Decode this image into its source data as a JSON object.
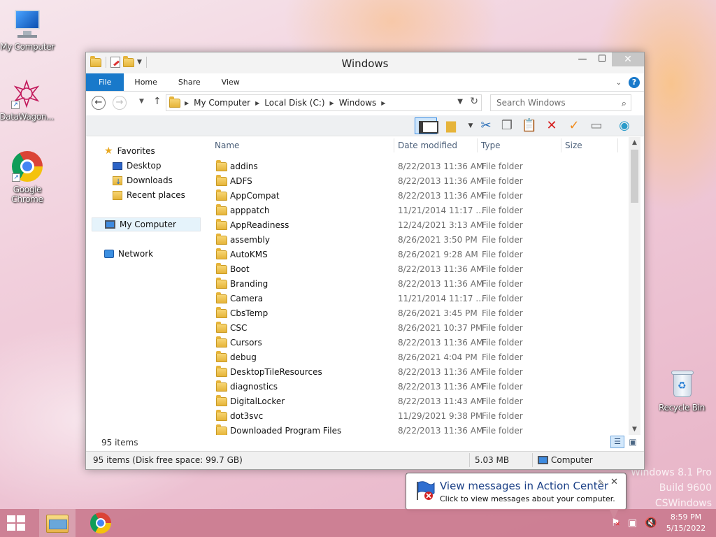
{
  "desktop": {
    "icons": [
      {
        "label": "My Computer",
        "icon": "computer-icon"
      },
      {
        "label": "DataWagon...",
        "icon": "datawagon-icon"
      },
      {
        "label": "Google Chrome",
        "icon": "chrome-icon"
      },
      {
        "label": "Recycle Bin",
        "icon": "recycle-bin-icon"
      }
    ],
    "watermark": {
      "line1": "Windows 8.1 Pro",
      "line2": "Build 9600",
      "line3": "CSWindows"
    }
  },
  "window": {
    "title": "Windows",
    "controls": {
      "minimize": "—",
      "maximize": "☐",
      "close": "✕"
    },
    "ribbon_tabs": [
      "File",
      "Home",
      "Share",
      "View"
    ],
    "address": {
      "crumbs": [
        "My Computer",
        "Local Disk (C:)",
        "Windows"
      ]
    },
    "search_placeholder": "Search Windows",
    "nav": {
      "favorites": "Favorites",
      "desktop": "Desktop",
      "downloads": "Downloads",
      "recent": "Recent places",
      "computer": "My Computer",
      "network": "Network"
    },
    "columns": {
      "name": "Name",
      "date": "Date modified",
      "type": "Type",
      "size": "Size"
    },
    "files": [
      {
        "name": "addins",
        "date": "8/22/2013 11:36 AM",
        "type": "File folder"
      },
      {
        "name": "ADFS",
        "date": "8/22/2013 11:36 AM",
        "type": "File folder"
      },
      {
        "name": "AppCompat",
        "date": "8/22/2013 11:36 AM",
        "type": "File folder"
      },
      {
        "name": "apppatch",
        "date": "11/21/2014 11:17 ...",
        "type": "File folder"
      },
      {
        "name": "AppReadiness",
        "date": "12/24/2021 3:13 AM",
        "type": "File folder"
      },
      {
        "name": "assembly",
        "date": "8/26/2021 3:50 PM",
        "type": "File folder"
      },
      {
        "name": "AutoKMS",
        "date": "8/26/2021 9:28 AM",
        "type": "File folder"
      },
      {
        "name": "Boot",
        "date": "8/22/2013 11:36 AM",
        "type": "File folder"
      },
      {
        "name": "Branding",
        "date": "8/22/2013 11:36 AM",
        "type": "File folder"
      },
      {
        "name": "Camera",
        "date": "11/21/2014 11:17 ...",
        "type": "File folder"
      },
      {
        "name": "CbsTemp",
        "date": "8/26/2021 3:45 PM",
        "type": "File folder"
      },
      {
        "name": "CSC",
        "date": "8/26/2021 10:37 PM",
        "type": "File folder"
      },
      {
        "name": "Cursors",
        "date": "8/22/2013 11:36 AM",
        "type": "File folder"
      },
      {
        "name": "debug",
        "date": "8/26/2021 4:04 PM",
        "type": "File folder"
      },
      {
        "name": "DesktopTileResources",
        "date": "8/22/2013 11:36 AM",
        "type": "File folder"
      },
      {
        "name": "diagnostics",
        "date": "8/22/2013 11:36 AM",
        "type": "File folder"
      },
      {
        "name": "DigitalLocker",
        "date": "8/22/2013 11:43 AM",
        "type": "File folder"
      },
      {
        "name": "dot3svc",
        "date": "11/29/2021 9:38 PM",
        "type": "File folder"
      },
      {
        "name": "Downloaded Program Files",
        "date": "8/22/2013 11:36 AM",
        "type": "File folder"
      }
    ],
    "item_count": "95 items",
    "status": {
      "disk": "95 items (Disk free space: 99.7 GB)",
      "size": "5.03 MB",
      "location": "Computer"
    }
  },
  "notification": {
    "title": "View messages in Action Center",
    "message": "Click to view messages about your computer."
  },
  "taskbar": {
    "time": "8:59 PM",
    "date": "5/15/2022"
  },
  "colors": {
    "accent": "#1979ca",
    "taskbar": "#c8788c"
  }
}
